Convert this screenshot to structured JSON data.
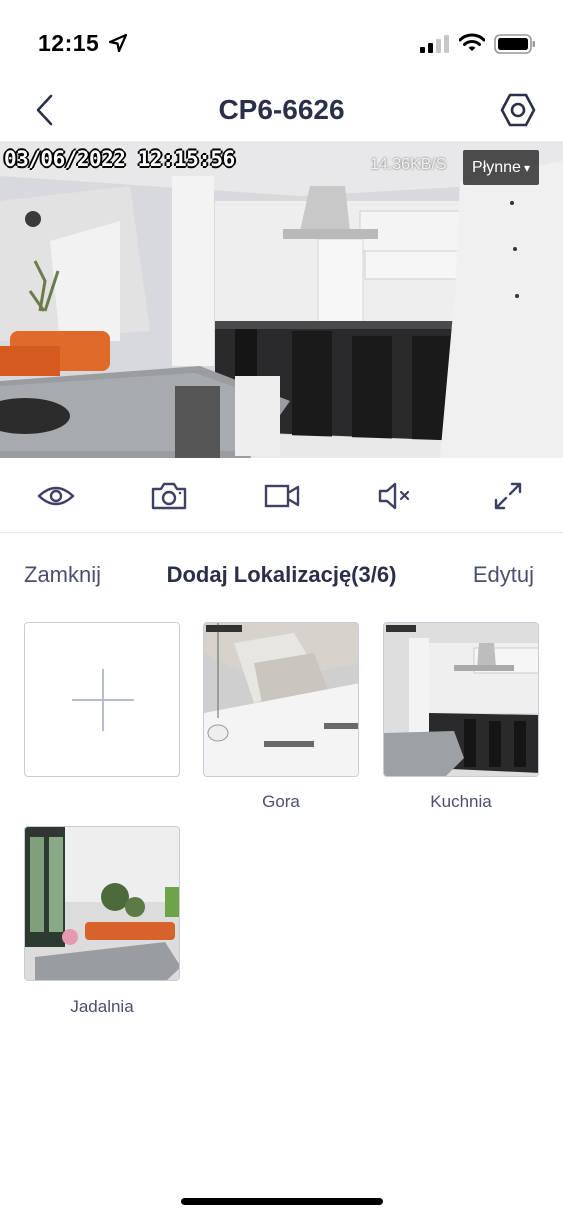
{
  "status_bar": {
    "time": "12:15",
    "icons": [
      "location-arrow-icon",
      "cellular-signal-icon",
      "wifi-icon",
      "battery-icon"
    ]
  },
  "nav": {
    "title": "CP6-6626",
    "back_icon": "chevron-left-icon",
    "settings_icon": "hexagon-settings-icon"
  },
  "video": {
    "timestamp": "03/06/2022 12:15:56",
    "bitrate": "14.36KB/S",
    "quality": "Płynne",
    "quality_caret": "▾"
  },
  "toolbar": {
    "icons": [
      "eye-icon",
      "camera-icon",
      "video-record-icon",
      "speaker-muted-icon",
      "fullscreen-icon"
    ]
  },
  "locations": {
    "close_label": "Zamknij",
    "title": "Dodaj Lokalizację(3/6)",
    "edit_label": "Edytuj",
    "items": [
      {
        "label": "Gora"
      },
      {
        "label": "Kuchnia"
      },
      {
        "label": "Jadalnia"
      }
    ]
  },
  "colors": {
    "text_primary": "#2b2f4a",
    "text_secondary": "#4b5070",
    "icon": "#3d4166"
  }
}
